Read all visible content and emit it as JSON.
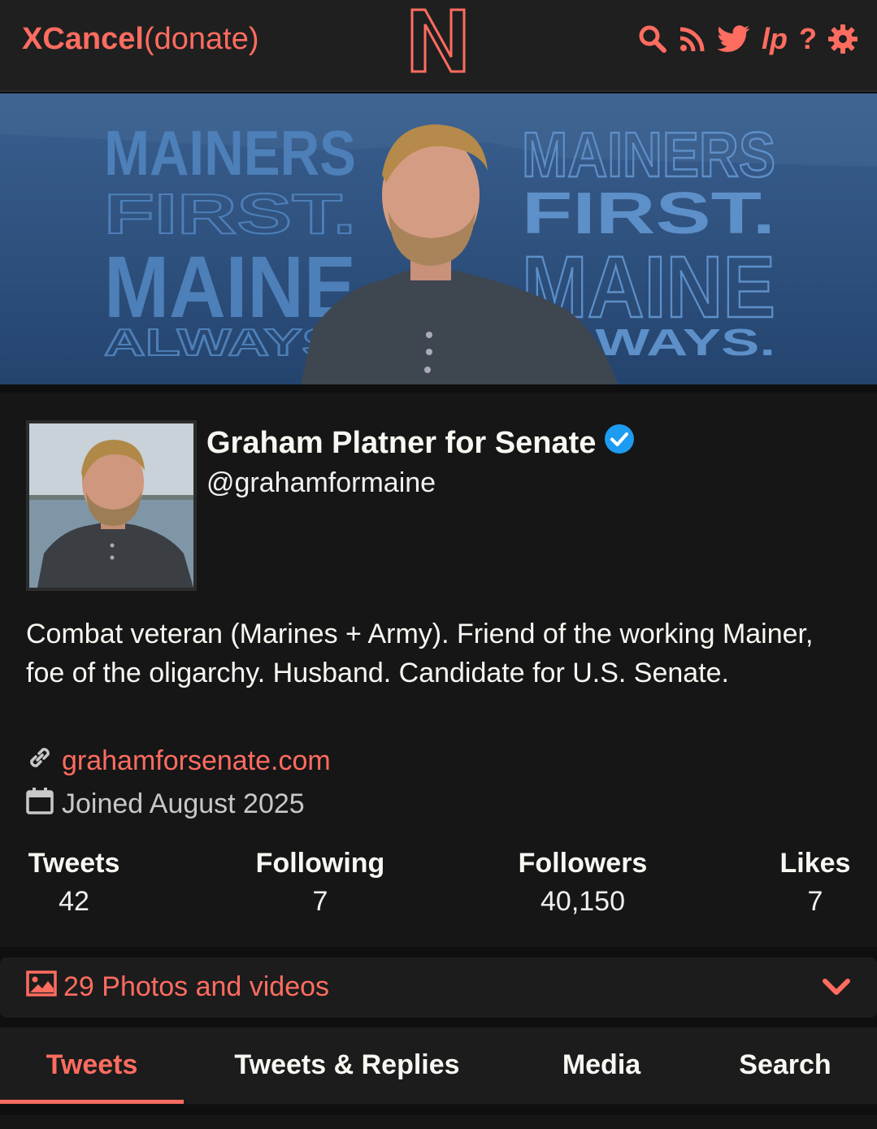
{
  "header": {
    "brand_name": "XCancel",
    "brand_suffix": "(donate)",
    "logo_letter": "N",
    "icons": [
      "search-icon",
      "rss-icon",
      "twitter-icon",
      "lp-icon",
      "help-icon",
      "settings-icon"
    ],
    "lp_text": "lp",
    "help_text": "?"
  },
  "banner": {
    "left_lines": [
      "MAINERS",
      "FIRST.",
      "MAINE",
      "ALWAYS."
    ],
    "right_lines": [
      "MAINERS",
      "FIRST.",
      "MAINE",
      "ALWAYS."
    ]
  },
  "profile": {
    "fullname": "Graham Platner for Senate",
    "username": "@grahamformaine",
    "bio": "Combat veteran (Marines + Army). Friend of the working Mainer, foe of the oligarchy. Husband. Candidate for U.S. Senate.",
    "website": "grahamforsenate.com",
    "joined": "Joined August 2025",
    "stats": {
      "tweets_label": "Tweets",
      "tweets_value": "42",
      "following_label": "Following",
      "following_value": "7",
      "followers_label": "Followers",
      "followers_value": "40,150",
      "likes_label": "Likes",
      "likes_value": "7"
    }
  },
  "photos": {
    "label": "29 Photos and videos"
  },
  "tabs": [
    {
      "label": "Tweets",
      "active": true
    },
    {
      "label": "Tweets & Replies",
      "active": false
    },
    {
      "label": "Media",
      "active": false
    },
    {
      "label": "Search",
      "active": false
    }
  ],
  "colors": {
    "accent": "#ff6c60",
    "verified": "#1d9bf0",
    "bg": "#161616",
    "topbar": "#1f1f1f"
  }
}
